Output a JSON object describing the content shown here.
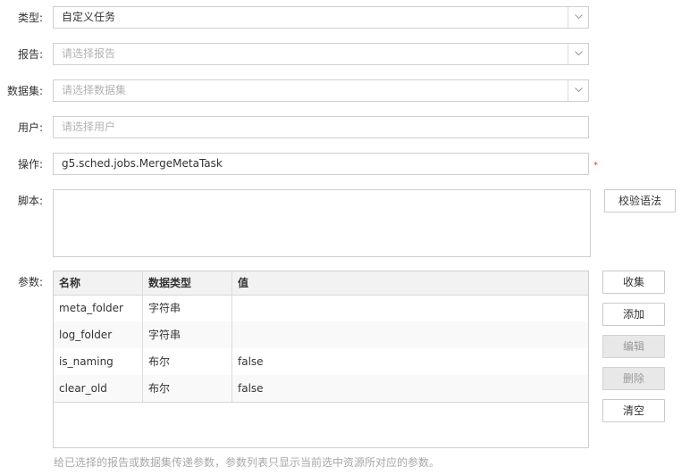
{
  "form": {
    "type": {
      "label": "类型:",
      "value": "自定义任务"
    },
    "report": {
      "label": "报告:",
      "placeholder": "请选择报告"
    },
    "dataset": {
      "label": "数据集:",
      "placeholder": "请选择数据集"
    },
    "user": {
      "label": "用户:",
      "placeholder": "请选择用户"
    },
    "operation": {
      "label": "操作:",
      "value": "g5.sched.jobs.MergeMetaTask",
      "required_mark": "*"
    },
    "script": {
      "label": "脚本:",
      "value": "",
      "check_syntax_button": "校验语法"
    },
    "params": {
      "label": "参数:",
      "columns": [
        "名称",
        "数据类型",
        "值"
      ],
      "rows": [
        {
          "name": "meta_folder",
          "type": "字符串",
          "value": ""
        },
        {
          "name": "log_folder",
          "type": "字符串",
          "value": ""
        },
        {
          "name": "is_naming",
          "type": "布尔",
          "value": "false"
        },
        {
          "name": "clear_old",
          "type": "布尔",
          "value": "false"
        }
      ],
      "buttons": {
        "collect": "收集",
        "add": "添加",
        "edit": "编辑",
        "delete": "删除",
        "clear": "清空"
      },
      "hint": "给已选择的报告或数据集传递参数，参数列表只显示当前选中资源所对应的参数。"
    }
  },
  "colors": {
    "required": "#e0413b",
    "border": "#cfcfcf",
    "header_bg": "#f2f2f2",
    "disabled_bg": "#e8e8e8"
  }
}
